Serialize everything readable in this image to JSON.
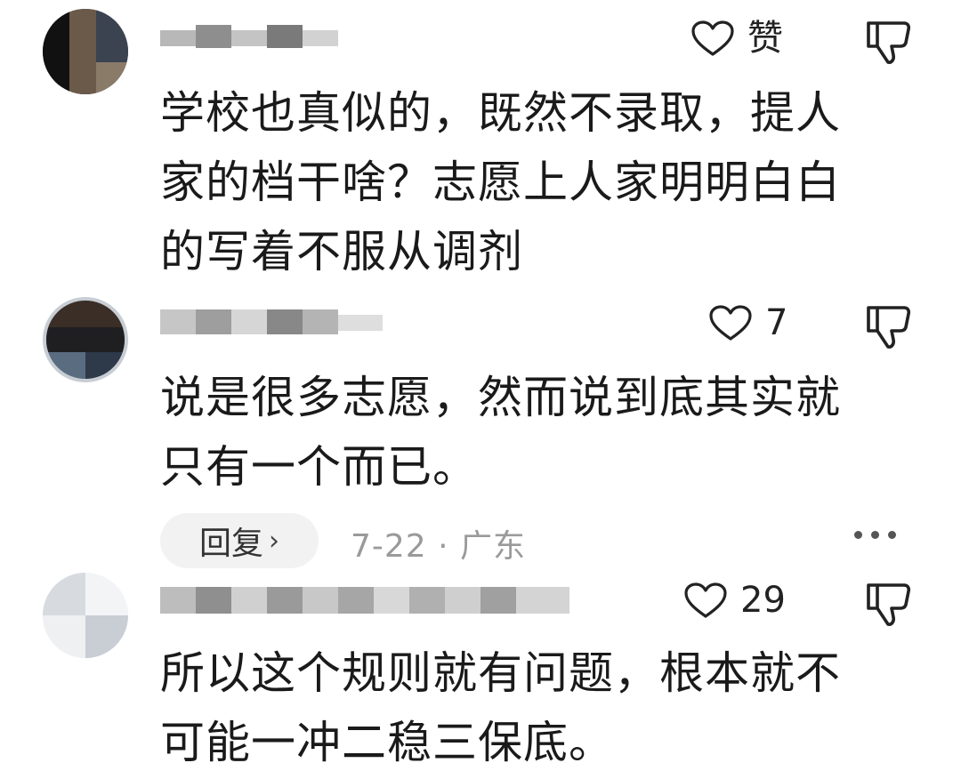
{
  "comments": [
    {
      "like_label": "赞",
      "lines": [
        "学校也真似的，既然不录取，提人",
        "家的档干啥？志愿上人家明明白白",
        "的写着不服从调剂"
      ]
    },
    {
      "like_count": "7",
      "lines": [
        "说是很多志愿，然而说到底其实就",
        "只有一个而已。"
      ],
      "reply_label": "回复",
      "reply_chevron": "›",
      "meta": "7-22 · 广东"
    },
    {
      "like_count": "29",
      "lines": [
        "所以这个规则就有问题，根本就不",
        "可能一冲二稳三保底。"
      ]
    }
  ],
  "icons": {
    "like": "heart-outline-icon",
    "dislike": "thumbs-down-icon",
    "more": "ellipsis-icon"
  },
  "colors": {
    "text": "#1a1a1a",
    "meta": "#9a9a9a",
    "reply_bg": "#f2f2f2"
  }
}
